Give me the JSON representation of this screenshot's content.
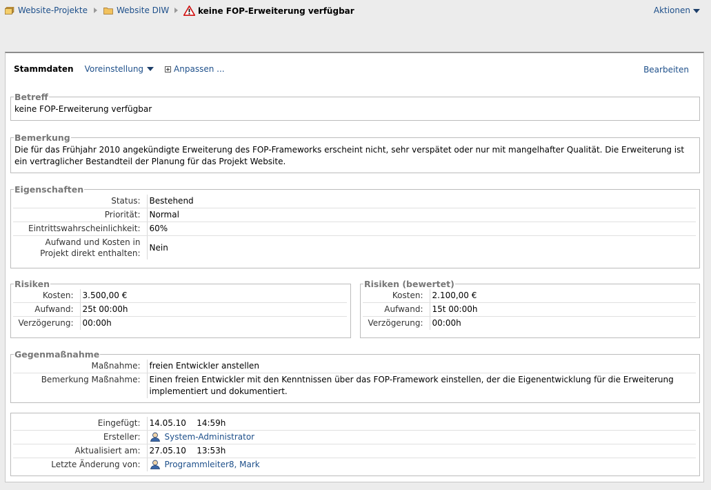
{
  "breadcrumb": {
    "items": [
      {
        "label": "Website-Projekte"
      },
      {
        "label": "Website DIW"
      }
    ],
    "current": "keine FOP-Erweiterung verfügbar",
    "actions_label": "Aktionen"
  },
  "tabs": {
    "active": "Stammdaten",
    "preset": "Voreinstellung",
    "customize": "Anpassen ...",
    "edit": "Bearbeiten"
  },
  "betreff": {
    "legend": "Betreff",
    "text": "keine FOP-Erweiterung verfügbar"
  },
  "bemerkung": {
    "legend": "Bemerkung",
    "text": "Die für das Frühjahr 2010 angekündigte Erweiterung des FOP-Frameworks erscheint nicht, sehr verspätet oder nur mit mangelhafter Qualität. Die Erweiterung ist ein vertraglicher Bestandteil der Planung für das Projekt Website."
  },
  "eigenschaften": {
    "legend": "Eigenschaften",
    "rows": [
      {
        "key": "Status:",
        "value": "Bestehend"
      },
      {
        "key": "Priorität:",
        "value": "Normal"
      },
      {
        "key": "Eintrittswahrscheinlichkeit:",
        "value": "60%"
      },
      {
        "key": "Aufwand und Kosten in Projekt direkt enthalten:",
        "value": "Nein"
      }
    ]
  },
  "risiken": {
    "legend": "Risiken",
    "rows": [
      {
        "key": "Kosten:",
        "value": "3.500,00 €"
      },
      {
        "key": "Aufwand:",
        "value": "25t 00:00h"
      },
      {
        "key": "Verzögerung:",
        "value": "00:00h"
      }
    ]
  },
  "risiken_bewertet": {
    "legend": "Risiken (bewertet)",
    "rows": [
      {
        "key": "Kosten:",
        "value": "2.100,00 €"
      },
      {
        "key": "Aufwand:",
        "value": "15t 00:00h"
      },
      {
        "key": "Verzögerung:",
        "value": "00:00h"
      }
    ]
  },
  "gegenmassnahme": {
    "legend": "Gegenmaßnahme",
    "rows": [
      {
        "key": "Maßnahme:",
        "value": "freien Entwickler anstellen"
      },
      {
        "key": "Bemerkung Maßnahme:",
        "value": "Einen freien Entwickler mit den Kenntnissen über das FOP-Framework einstellen, der die Eigenentwicklung für die Erweiterung implementiert und dokumentiert."
      }
    ]
  },
  "meta": {
    "rows": [
      {
        "key": "Eingefügt:",
        "date": "14.05.10",
        "time": "14:59h"
      },
      {
        "key": "Ersteller:",
        "user": "System-Administrator"
      },
      {
        "key": "Aktualisiert am:",
        "date": "27.05.10",
        "time": "13:53h"
      },
      {
        "key": "Letzte Änderung von:",
        "user": "Programmleiter8, Mark"
      }
    ]
  },
  "icons": {
    "folder": "folder-icon",
    "warning": "warning-icon",
    "user": "user-icon"
  },
  "colors": {
    "link": "#1d4f8a",
    "legend": "#777777",
    "warning": "#d01010"
  }
}
